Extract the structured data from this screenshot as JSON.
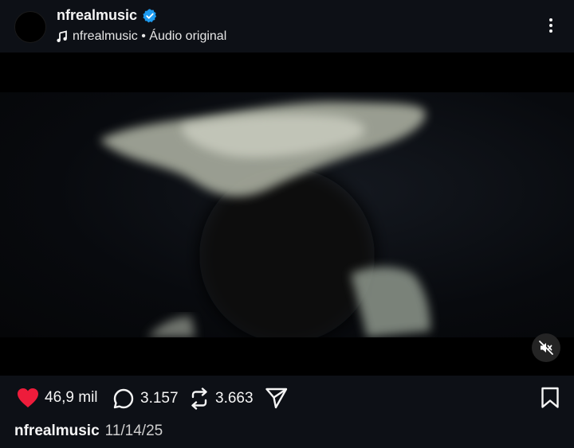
{
  "post": {
    "username": "nfrealmusic",
    "verified": true,
    "audio_text": "nfrealmusic • Áudio original",
    "date": "11/14/25"
  },
  "media": {
    "muted": true
  },
  "actions": {
    "likes": "46,9 mil",
    "liked": true,
    "comments": "3.157",
    "reposts": "3.663"
  },
  "colors": {
    "background": "#0d1016",
    "like_red": "#ee1c3b",
    "verified_blue": "#1d9bf0"
  },
  "icons": [
    "verified-badge-icon",
    "music-note-icon",
    "more-options-icon",
    "mute-icon",
    "heart-icon",
    "comment-icon",
    "repost-icon",
    "share-icon",
    "bookmark-icon"
  ]
}
